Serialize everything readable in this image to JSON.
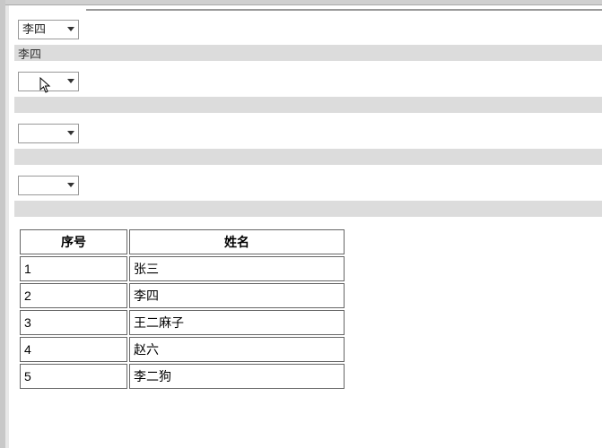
{
  "dropdowns": [
    {
      "value": "李四"
    },
    {
      "value": ""
    },
    {
      "value": ""
    },
    {
      "value": ""
    }
  ],
  "bars": [
    {
      "label": "李四"
    },
    {
      "label": ""
    },
    {
      "label": ""
    },
    {
      "label": ""
    }
  ],
  "table": {
    "headers": [
      "序号",
      "姓名"
    ],
    "rows": [
      [
        "1",
        "张三"
      ],
      [
        "2",
        "李四"
      ],
      [
        "3",
        "王二麻子"
      ],
      [
        "4",
        "赵六"
      ],
      [
        "5",
        "李二狗"
      ]
    ]
  }
}
